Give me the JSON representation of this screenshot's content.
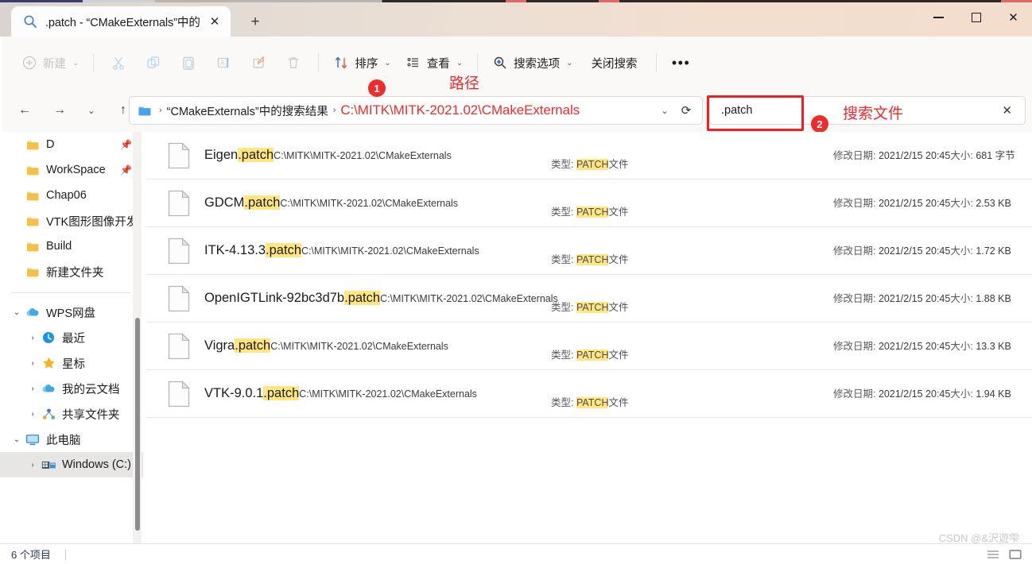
{
  "window": {
    "tab_title": ".patch - “CMakeExternals”中的",
    "tab_icon": "search-icon",
    "new_tab_label": "+",
    "minimize_label": "—",
    "maximize_label": "□",
    "close_label": "✕"
  },
  "toolbar": {
    "new_label": "新建",
    "cut_label": "剪切",
    "copy_label": "复制",
    "paste_label": "粘贴",
    "rename_label": "重命名",
    "share_label": "共享",
    "delete_label": "删除",
    "sort_label": "排序",
    "view_label": "查看",
    "search_options_label": "搜索选项",
    "close_search_label": "关闭搜索",
    "more_label": "•••",
    "chevron": "⌄"
  },
  "address": {
    "back_label": "←",
    "forward_label": "→",
    "history_label": "⌄",
    "up_label": "↑",
    "crumb_search_results": "“CMakeExternals”中的搜索结果",
    "crumb_path": "C:\\MITK\\MITK-2021.02\\CMakeExternals",
    "separator": "›",
    "dropdown_label": "⌄",
    "refresh_label": "⟳"
  },
  "search": {
    "value": ".patch",
    "clear_label": "✕"
  },
  "annotations": {
    "badge1": "1",
    "badge2": "2",
    "path_label": "路径",
    "search_label": "搜索文件",
    "color": "#f02b2b"
  },
  "sidebar": {
    "quick_items": [
      {
        "label": "D",
        "icon": "folder-icon",
        "pinned": true,
        "chevron": ""
      },
      {
        "label": "WorkSpace",
        "icon": "folder-icon",
        "pinned": true,
        "chevron": ""
      },
      {
        "label": "Chap06",
        "icon": "folder-icon",
        "pinned": false,
        "chevron": ""
      },
      {
        "label": "VTK图形图像开发",
        "icon": "folder-icon",
        "pinned": false,
        "chevron": ""
      },
      {
        "label": "Build",
        "icon": "folder-icon",
        "pinned": false,
        "chevron": ""
      },
      {
        "label": "新建文件夹",
        "icon": "folder-icon",
        "pinned": false,
        "chevron": ""
      }
    ],
    "tree_items": [
      {
        "label": "WPS网盘",
        "icon": "cloud-icon",
        "chevron": "⌄",
        "indent": 0,
        "selected": false
      },
      {
        "label": "最近",
        "icon": "clock-icon",
        "chevron": "›",
        "indent": 1,
        "selected": false
      },
      {
        "label": "星标",
        "icon": "star-icon",
        "chevron": "›",
        "indent": 1,
        "selected": false
      },
      {
        "label": "我的云文档",
        "icon": "cloud-icon",
        "chevron": "›",
        "indent": 1,
        "selected": false
      },
      {
        "label": "共享文件夹",
        "icon": "share-nodes-icon",
        "chevron": "›",
        "indent": 1,
        "selected": false
      },
      {
        "label": "此电脑",
        "icon": "monitor-icon",
        "chevron": "⌄",
        "indent": 0,
        "selected": false
      },
      {
        "label": "Windows (C:)",
        "icon": "drive-icon",
        "chevron": "›",
        "indent": 1,
        "selected": true
      }
    ]
  },
  "filelist": {
    "type_label": "类型:",
    "type_suffix": "文件",
    "type_highlight": "PATCH",
    "date_label": "修改日期:",
    "size_label": "大小:",
    "rows": [
      {
        "name_prefix": "Eigen",
        "name_highlight": ".patch",
        "path": "C:\\MITK\\MITK-2021.02\\CMakeExternals",
        "date": "2021/2/15 20:45",
        "size": "681 字节"
      },
      {
        "name_prefix": "GDCM",
        "name_highlight": ".patch",
        "path": "C:\\MITK\\MITK-2021.02\\CMakeExternals",
        "date": "2021/2/15 20:45",
        "size": "2.53 KB"
      },
      {
        "name_prefix": "ITK-4.13.3",
        "name_highlight": ".patch",
        "path": "C:\\MITK\\MITK-2021.02\\CMakeExternals",
        "date": "2021/2/15 20:45",
        "size": "1.72 KB"
      },
      {
        "name_prefix": "OpenIGTLink-92bc3d7b",
        "name_highlight": ".patch",
        "path": "C:\\MITK\\MITK-2021.02\\CMakeExternals",
        "date": "2021/2/15 20:45",
        "size": "1.88 KB"
      },
      {
        "name_prefix": "Vigra",
        "name_highlight": ".patch",
        "path": "C:\\MITK\\MITK-2021.02\\CMakeExternals",
        "date": "2021/2/15 20:45",
        "size": "13.3 KB"
      },
      {
        "name_prefix": "VTK-9.0.1",
        "name_highlight": ".patch",
        "path": "C:\\MITK\\MITK-2021.02\\CMakeExternals",
        "date": "2021/2/15 20:45",
        "size": "1.94 KB"
      }
    ]
  },
  "statusbar": {
    "item_count": "6 个项目"
  },
  "watermark": {
    "text": "CSDN @&沢遊雫"
  }
}
